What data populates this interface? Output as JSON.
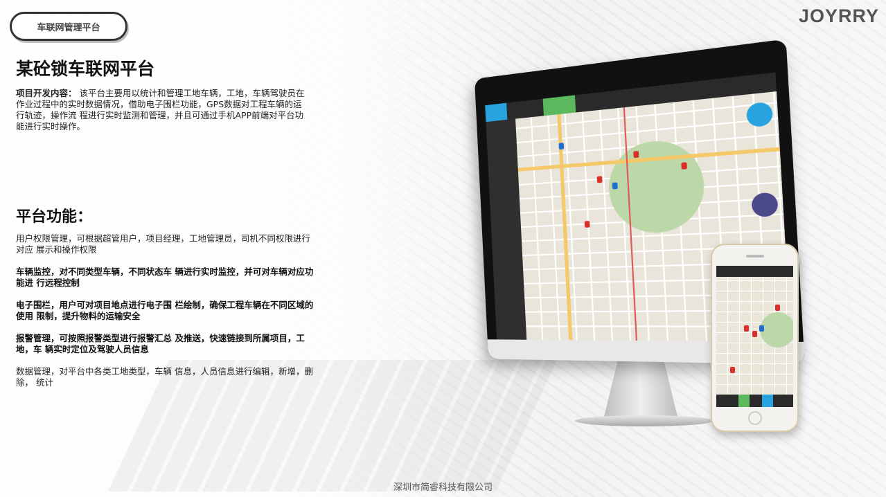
{
  "header": {
    "badge_label": "车联网管理平台",
    "brand": "JOYRRY"
  },
  "project": {
    "title": "某砼锁车联网平台",
    "desc_label": "项目开发内容：",
    "desc_text": " 该平台主要用以统计和管理工地车辆，工地，车辆驾驶员在作业过程中的实时数据情况，借助电子围栏功能，GPS数据对工程车辆的运行轨迹，操作流 程进行实时监测和管理，并且可通过手机APP前端对平台功能进行实时操作。"
  },
  "features": {
    "title": "平台功能：",
    "items": [
      {
        "text": "用户权限管理，可根据超管用户，项目经理，工地管理员，司机不同权限进行对应 展示和操作权限",
        "bold": false
      },
      {
        "text": "车辆监控，对不同类型车辆，不同状态车 辆进行实时监控，并可对车辆对应功能进 行远程控制",
        "bold": true
      },
      {
        "text": "电子围栏，用户可对项目地点进行电子围 栏绘制，确保工程车辆在不同区域的使用 限制，提升物料的运输安全",
        "bold": true
      },
      {
        "text": "报警管理，可按照报警类型进行报警汇总 及推送，快速链接到所属项目，工地，车 辆实时定位及驾驶人员信息",
        "bold": true
      },
      {
        "text": "数据管理，对平台中各类工地类型，车辆 信息，人员信息进行编辑，新增，删除， 统计",
        "bold": false
      }
    ]
  },
  "footer": {
    "company": "深圳市简睿科技有限公司"
  },
  "colors": {
    "accent_blue": "#29a3e0",
    "accent_green": "#5cb85c",
    "pin_red": "#d9302c"
  }
}
